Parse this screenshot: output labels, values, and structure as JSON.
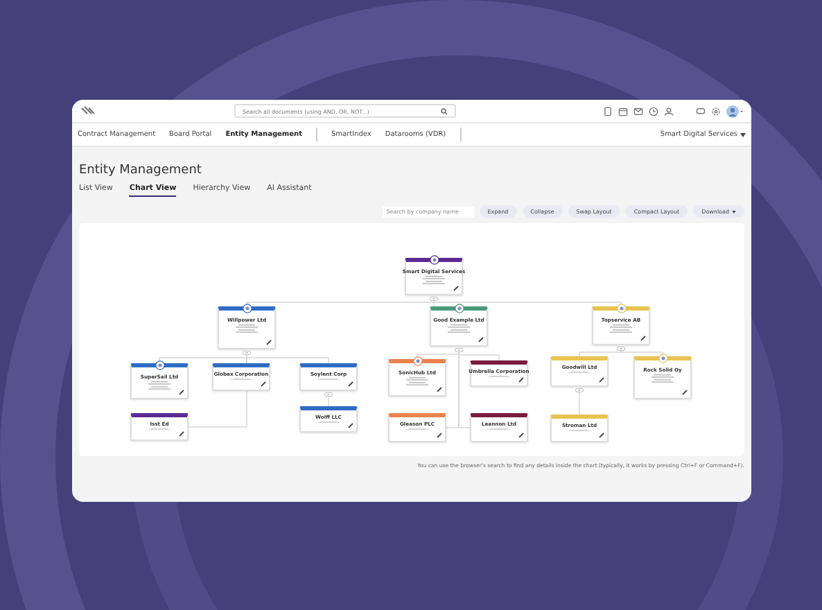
{
  "top_bar": {
    "search": {
      "placeholder": "Search all documents (using AND, OR, NOT...)"
    }
  },
  "nav_tabs": [
    {
      "label": "Contract Management",
      "selected": false
    },
    {
      "label": "Board Portal",
      "selected": false
    },
    {
      "label": "Entity Management",
      "selected": true
    },
    {
      "label": "SmartIndex",
      "selected": false
    },
    {
      "label": "Datarooms (VDR)",
      "selected": false
    }
  ],
  "company_menu": "Smart Digital Services",
  "title": "Entity Management",
  "view_tabs": [
    {
      "label": "List View",
      "selected": false
    },
    {
      "label": "Chart View",
      "selected": true
    },
    {
      "label": "Hierarchy View",
      "selected": false
    },
    {
      "label": "AI Assistant",
      "selected": false
    }
  ],
  "toolbar": {
    "search": {
      "placeholder": "Search by company name"
    },
    "buttons": [
      "Expand",
      "Collapse",
      "Swap Layout",
      "Compact Layout",
      "Download"
    ]
  },
  "org_chart": {
    "root": {
      "name": "Smart Digital Services",
      "color": "#5b2a93",
      "logo": true,
      "children": [
        {
          "name": "Willpower Ltd",
          "color": "#2f6dc4",
          "logo": true,
          "children": [
            {
              "name": "SuperSail Ltd",
              "color": "#2f6dc4",
              "logo": true
            },
            {
              "name": "Globex Corporation",
              "color": "#2f6dc4",
              "logo": false
            },
            {
              "name": "Soylent Corp",
              "color": "#2f6dc4",
              "logo": false,
              "children": [
                {
                  "name": "Wolff LLC",
                  "color": "#2f6dc4",
                  "logo": false
                }
              ]
            },
            {
              "name": "Isst Ed",
              "color": "#5b2a93",
              "logo": false
            }
          ]
        },
        {
          "name": "Good Example Ltd",
          "color": "#4a9a7a",
          "logo": true,
          "children": [
            {
              "name": "SonicHub Ltd",
              "color": "#e8834c",
              "logo": true
            },
            {
              "name": "Umbrella Corporation",
              "color": "#7a1d3f",
              "logo": false
            },
            {
              "name": "Gleason PLC",
              "color": "#e8834c",
              "logo": false
            },
            {
              "name": "Leannon Ltd",
              "color": "#7a1d3f",
              "logo": false
            }
          ]
        },
        {
          "name": "Topservice AB",
          "color": "#e8c34f",
          "logo": true,
          "children": [
            {
              "name": "Goodwill Ltd",
              "color": "#e8c34f",
              "logo": false,
              "children": [
                {
                  "name": "Stroman Ltd",
                  "color": "#e8c34f",
                  "logo": false
                }
              ]
            },
            {
              "name": "Rock Solid Oy",
              "color": "#e8c34f",
              "logo": true
            }
          ]
        }
      ]
    }
  },
  "footer_note": "You can use the browser's search to find any details inside the chart (typically, it works by pressing Ctrl+F or Command+F)."
}
